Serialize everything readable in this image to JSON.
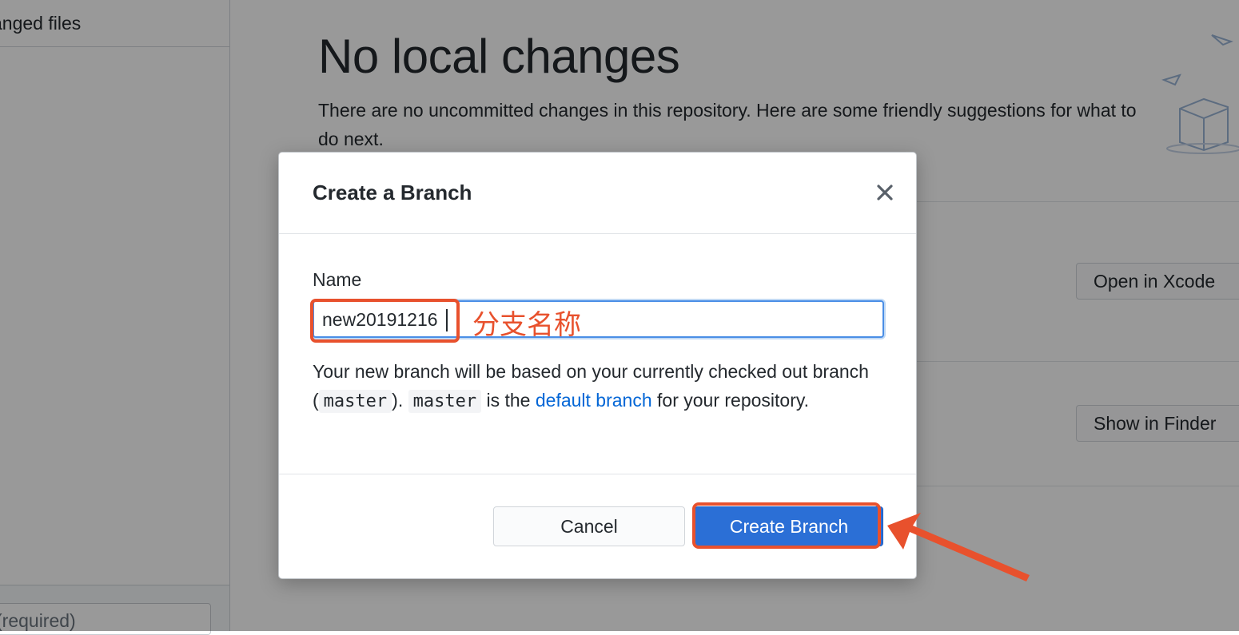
{
  "sidebar": {
    "header_label": "anged files",
    "summary_placeholder": "(required)"
  },
  "main": {
    "title": "No local changes",
    "description": "There are no uncommitted changes in this repository. Here are some friendly suggestions for what to do next.",
    "actions": {
      "open_xcode_label": "Open in Xcode",
      "show_finder_label": "Show in Finder"
    }
  },
  "dialog": {
    "title": "Create a Branch",
    "close_icon": "close-icon",
    "name_label": "Name",
    "name_value": "new20191216",
    "annotation": "分支名称",
    "helper": {
      "part1": "Your new branch will be based on your currently checked out branch (",
      "branch": "master",
      "part2": "). ",
      "branch2": "master",
      "part3": " is the ",
      "link": "default branch",
      "part4": " for your repository."
    },
    "cancel_label": "Cancel",
    "create_label": "Create Branch"
  },
  "colors": {
    "accent": "#2b6fd6",
    "annotation": "#e8512d",
    "link": "#0366d6"
  }
}
